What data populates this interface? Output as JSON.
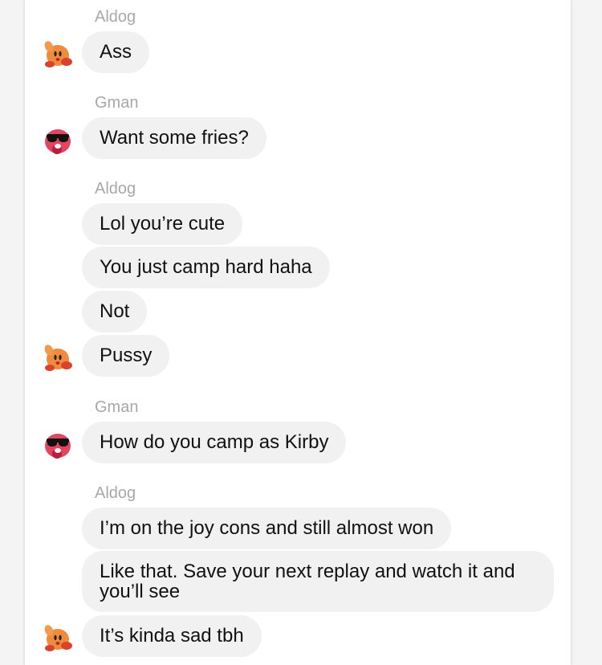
{
  "messages": [
    {
      "sender": "Aldog"
    },
    {
      "text": "Ass"
    },
    {
      "sender": "Gman"
    },
    {
      "text": "Want some fries?"
    },
    {
      "sender": "Aldog"
    },
    {
      "text": "Lol you’re cute"
    },
    {
      "text": "You just camp hard haha"
    },
    {
      "text": "Not"
    },
    {
      "text": "Pussy"
    },
    {
      "sender": "Gman"
    },
    {
      "text": "How do you camp as Kirby"
    },
    {
      "sender": "Aldog"
    },
    {
      "text": "I’m on the joy cons and still almost won"
    },
    {
      "text": "Like that. Save your next replay and watch it and you’ll see"
    },
    {
      "text": "It’s kinda sad tbh"
    }
  ],
  "avatars": {
    "aldog_icon": "kirby-waving-icon",
    "gman_icon": "kirby-sunglasses-icon",
    "aldog_color": "#f08a3c",
    "gman_color": "#e34560"
  }
}
